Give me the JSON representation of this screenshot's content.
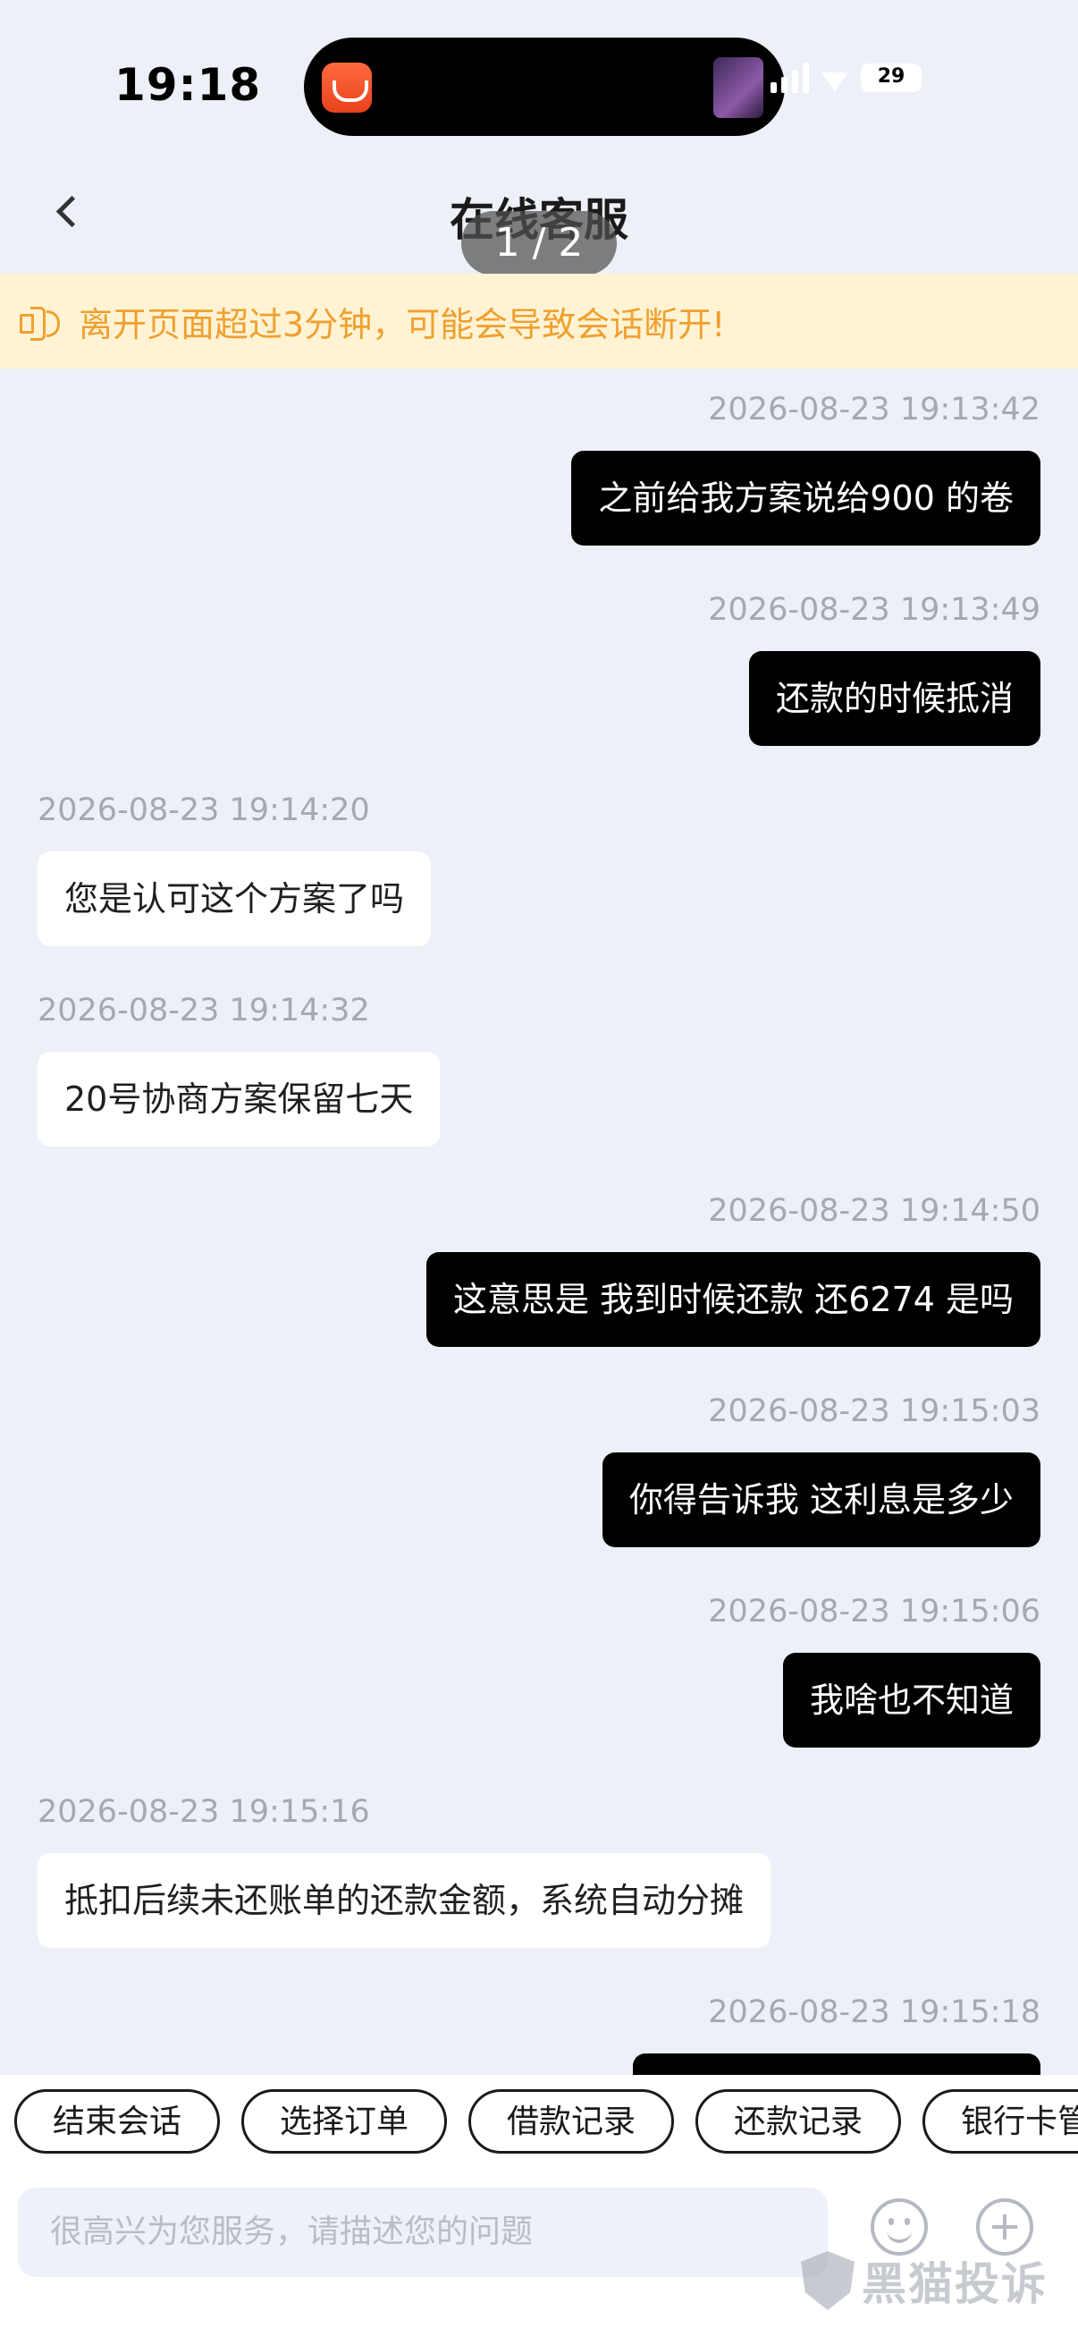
{
  "status_bar": {
    "time": "19:18",
    "battery": "29"
  },
  "nav": {
    "title": "在线客服",
    "page_indicator": "1 / 2"
  },
  "notice": {
    "text": "离开页面超过3分钟，可能会导致会话断开!"
  },
  "messages": [
    {
      "direction": "out",
      "time": "2026-08-23 19:13:42",
      "text": "之前给我方案说给900 的卷"
    },
    {
      "direction": "out",
      "time": "2026-08-23 19:13:49",
      "text": "还款的时候抵消"
    },
    {
      "direction": "in",
      "time": "2026-08-23 19:14:20",
      "text": "您是认可这个方案了吗"
    },
    {
      "direction": "in",
      "time": "2026-08-23 19:14:32",
      "text": "20号协商方案保留七天"
    },
    {
      "direction": "out",
      "time": "2026-08-23 19:14:50",
      "text": "这意思是 我到时候还款 还6274 是吗"
    },
    {
      "direction": "out",
      "time": "2026-08-23 19:15:03",
      "text": "你得告诉我 这利息是多少"
    },
    {
      "direction": "out",
      "time": "2026-08-23 19:15:06",
      "text": "我啥也不知道"
    },
    {
      "direction": "in",
      "time": "2026-08-23 19:15:16",
      "text": "抵扣后续未还账单的还款金额，系统自动分摊"
    },
    {
      "direction": "out",
      "time": "2026-08-23 19:15:18",
      "text": ""
    }
  ],
  "quick_actions": [
    "结束会话",
    "选择订单",
    "借款记录",
    "还款记录",
    "银行卡管"
  ],
  "input": {
    "placeholder": "很高兴为您服务，请描述您的问题"
  },
  "watermark": {
    "text": "黑猫投诉"
  }
}
